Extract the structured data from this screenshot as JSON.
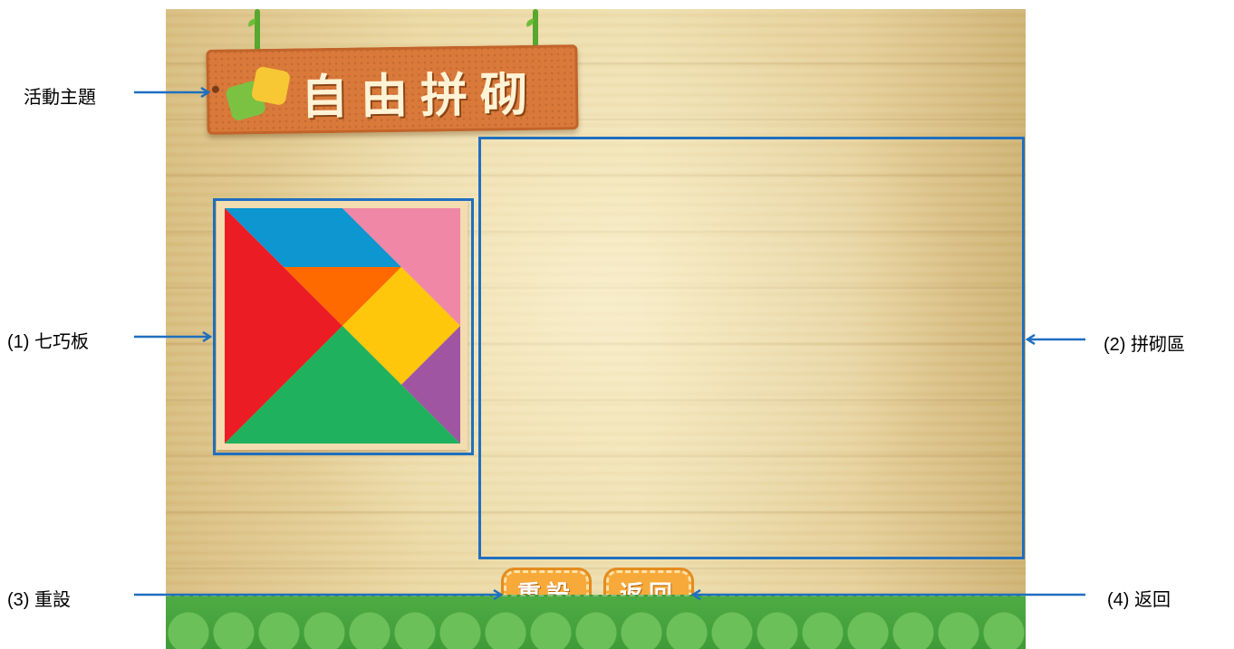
{
  "game": {
    "title": "自由拼砌",
    "buttons": {
      "reset": "重設",
      "back": "返回"
    },
    "tangram_colors": {
      "blue": "#0d96d0",
      "pink": "#f087a6",
      "red": "#eb1c24",
      "orange": "#ff6a00",
      "yellow": "#ffc70b",
      "green": "#20b15e",
      "purple": "#9f55a2"
    }
  },
  "annotations": {
    "topic": "活動主題",
    "tangram": "(1)  七巧板",
    "build_area": "(2)  拼砌區",
    "reset": "(3)  重設",
    "back": "(4)  返回",
    "color": "#1f6fbf"
  }
}
